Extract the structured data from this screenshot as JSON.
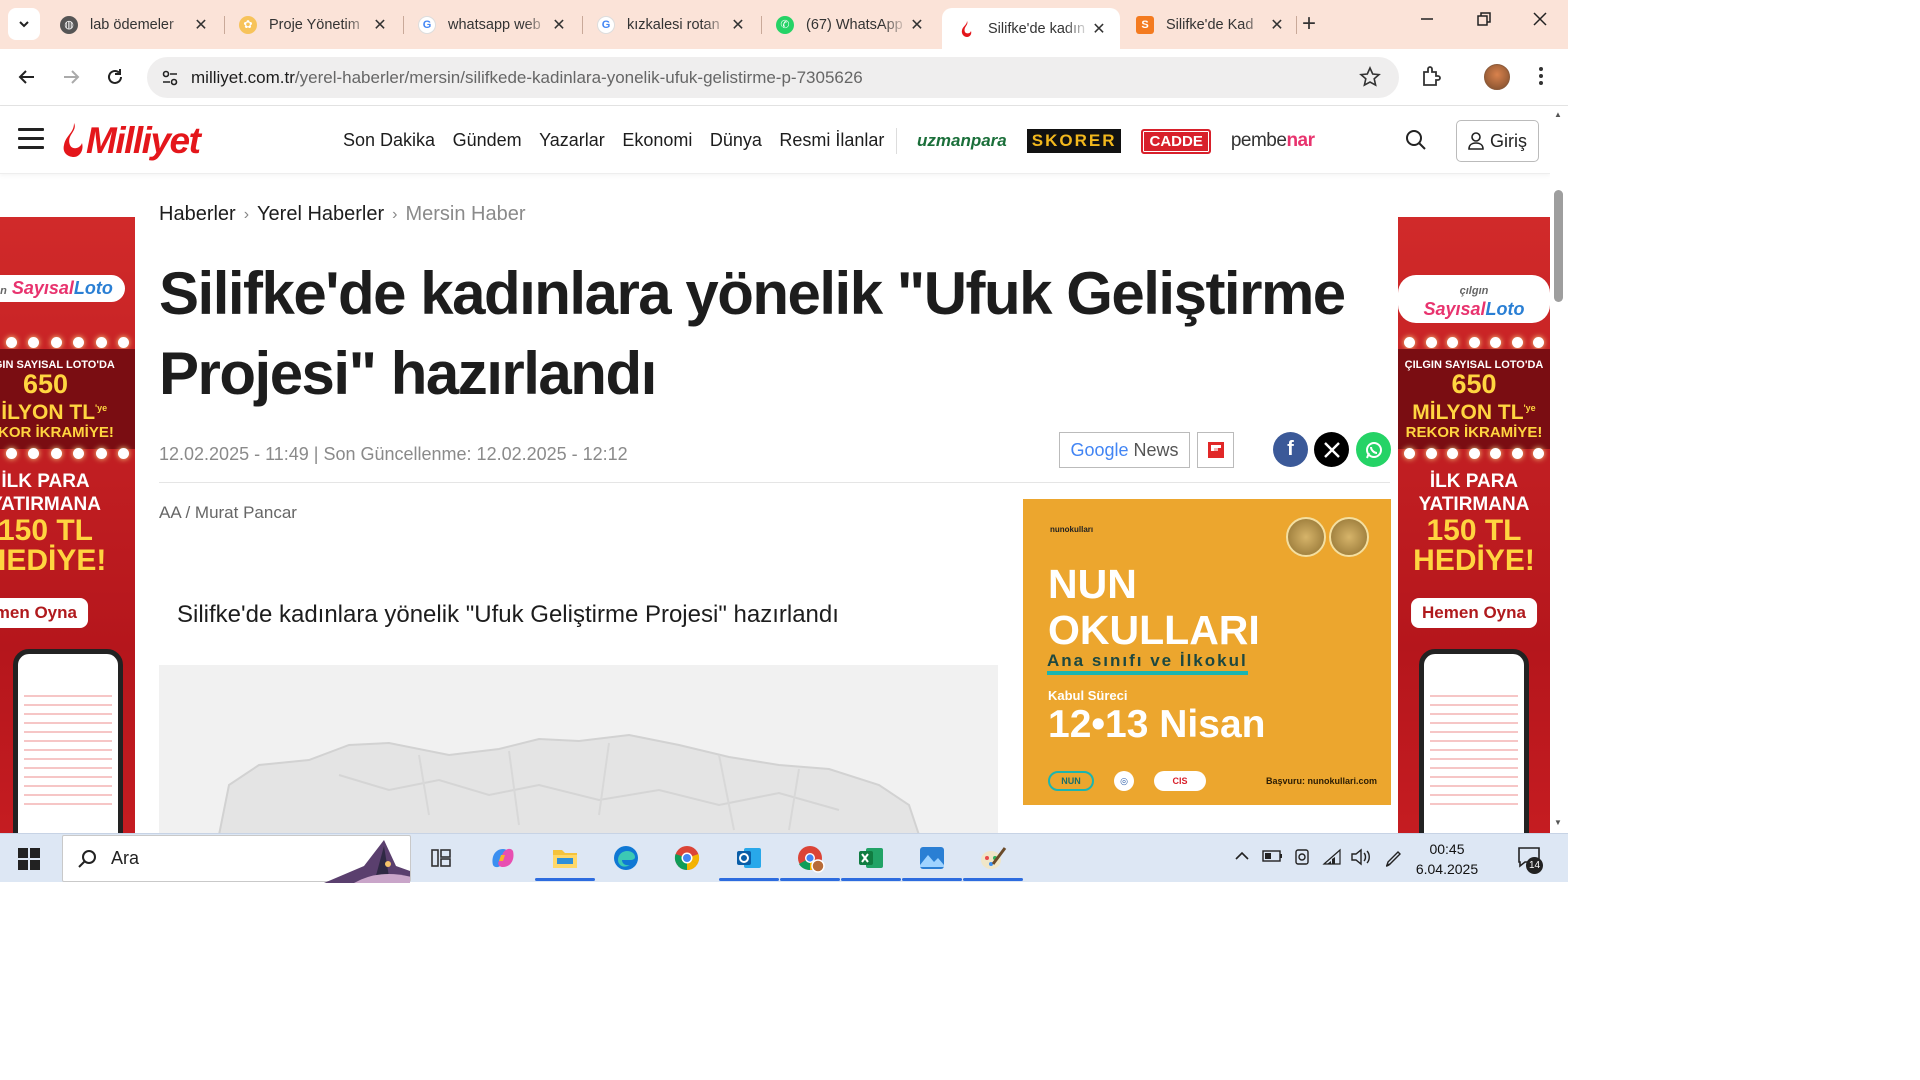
{
  "browser": {
    "tabs": [
      {
        "title": "lab ödemeler",
        "favicon": "globe-icon",
        "active": false
      },
      {
        "title": "Proje Yönetim",
        "favicon": "flower-icon",
        "active": false
      },
      {
        "title": "whatsapp web",
        "favicon": "google-icon",
        "active": false
      },
      {
        "title": "kızkalesi rotan",
        "favicon": "google-icon",
        "active": false
      },
      {
        "title": "(67) WhatsApp",
        "favicon": "whatsapp-icon",
        "active": false
      },
      {
        "title": "Silifke'de kadın",
        "favicon": "milliyet-flame-icon",
        "active": true
      },
      {
        "title": "Silifke'de Kad",
        "favicon": "s-letter-icon",
        "active": false
      }
    ],
    "url_domain": "milliyet.com.tr",
    "url_path": "/yerel-haberler/mersin/silifkede-kadinlara-yonelik-ufuk-gelistirme-p-7305626"
  },
  "site": {
    "logo": "Milliyet",
    "nav": [
      "Son Dakika",
      "Gündem",
      "Yazarlar",
      "Ekonomi",
      "Dünya",
      "Resmi İlanlar"
    ],
    "brands": {
      "uzmanpara": "uzmanpara",
      "skorer": "SKORER",
      "cadde": "CADDE",
      "pembenar_a": "pembe",
      "pembenar_b": "nar"
    },
    "login": "Giriş"
  },
  "article": {
    "breadcrumb": [
      "Haberler",
      "Yerel Haberler",
      "Mersin Haber"
    ],
    "headline": "Silifke'de kadınlara yönelik \"Ufuk Geliştirme Projesi\" hazırlandı",
    "dates": "12.02.2025 - 11:49 | Son Güncellenme: 12.02.2025 - 12:12",
    "google_news": {
      "google": "Google",
      "news": "News"
    },
    "source": "AA / Murat Pancar",
    "subtitle": "Silifke'de kadınlara yönelik \"Ufuk Geliştirme Projesi\" hazırlandı"
  },
  "side_ad": {
    "logo_a": "çılgın",
    "logo_b": "Sayısal",
    "logo_c": "Loto",
    "line1": "ÇILGIN SAYISAL LOTO'DA",
    "line2": "650",
    "line3": "MİLYON TL",
    "line3b": "'ye",
    "line4": "REKOR İKRAMİYE!",
    "line5": "İLK PARA",
    "line6": "YATIRMANA",
    "line7": "150 TL",
    "line8": "HEDİYE!",
    "button": "Hemen Oyna"
  },
  "nun_ad": {
    "brand": "nunokulları",
    "title1": "NUN",
    "title2": "OKULLARI",
    "sub": "Ana sınıfı ve İlkokul",
    "kabul": "Kabul Süreci",
    "dates": "12•13 Nisan",
    "cis": "CIS",
    "footer_url": "Başvuru: nunokullari.com"
  },
  "taskbar": {
    "search_placeholder": "Ara",
    "time": "00:45",
    "date": "6.04.2025",
    "notifications": "14"
  },
  "colors": {
    "milliyet_red": "#e4161b",
    "ad_orange": "#eca62e",
    "tab_bar": "#fbe3d8"
  }
}
